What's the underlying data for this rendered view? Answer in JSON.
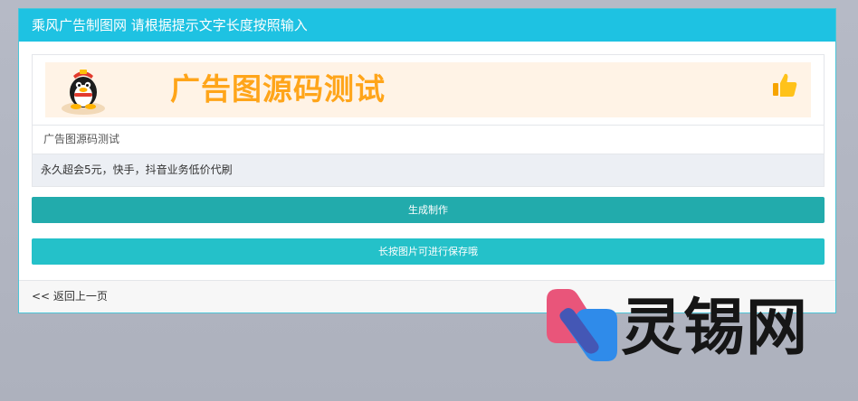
{
  "header": {
    "title": "乘风广告制图网 请根据提示文字长度按照输入"
  },
  "banner": {
    "text": "广告图源码测试",
    "penguin_icon": "qq-penguin-icon",
    "thumb_icon": "thumbs-up-icon",
    "text_color": "#ffa51a",
    "background": "#fff3e6"
  },
  "preview": {
    "caption": "广告图源码测试",
    "subtitle": "永久超会5元，快手，抖音业务低价代刷"
  },
  "buttons": {
    "generate_label": "生成制作",
    "save_label": "长按图片可进行保存哦",
    "generate_color": "#22abac",
    "save_color": "#24c1c9"
  },
  "footer": {
    "back_link": "<< 返回上一页"
  },
  "watermark": {
    "text": "灵锡网",
    "icon": "lingxi-logo-icon"
  },
  "colors": {
    "header": "#1ec2e2",
    "border": "#4cc5d8"
  }
}
